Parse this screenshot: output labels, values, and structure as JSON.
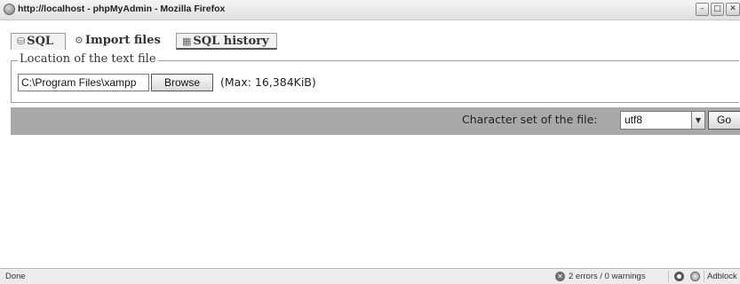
{
  "window": {
    "title": "http://localhost - phpMyAdmin - Mozilla Firefox",
    "buttons": {
      "minimize": "–",
      "maximize": "□",
      "close": "✕"
    }
  },
  "tabs": [
    {
      "label": "SQL",
      "icon": "sql-icon",
      "glyph": "⛁",
      "active": false
    },
    {
      "label": "Import files",
      "icon": "import-icon",
      "glyph": "⚙",
      "active": true
    },
    {
      "label": "SQL history",
      "icon": "history-icon",
      "glyph": "▦",
      "active": false
    }
  ],
  "import": {
    "legend": "Location of the text file",
    "file_value": "C:\\Program Files\\xampp",
    "browse_label": "Browse",
    "max_size": "(Max: 16,384KiB)"
  },
  "charset": {
    "label": "Character set of the file:",
    "selected": "utf8",
    "go_label": "Go"
  },
  "status": {
    "text": "Done",
    "errors": "2 errors / 0 warnings",
    "addon": "Adblock"
  },
  "colors": {
    "band": "#a9a9a9",
    "statusbar": "#ececec"
  }
}
